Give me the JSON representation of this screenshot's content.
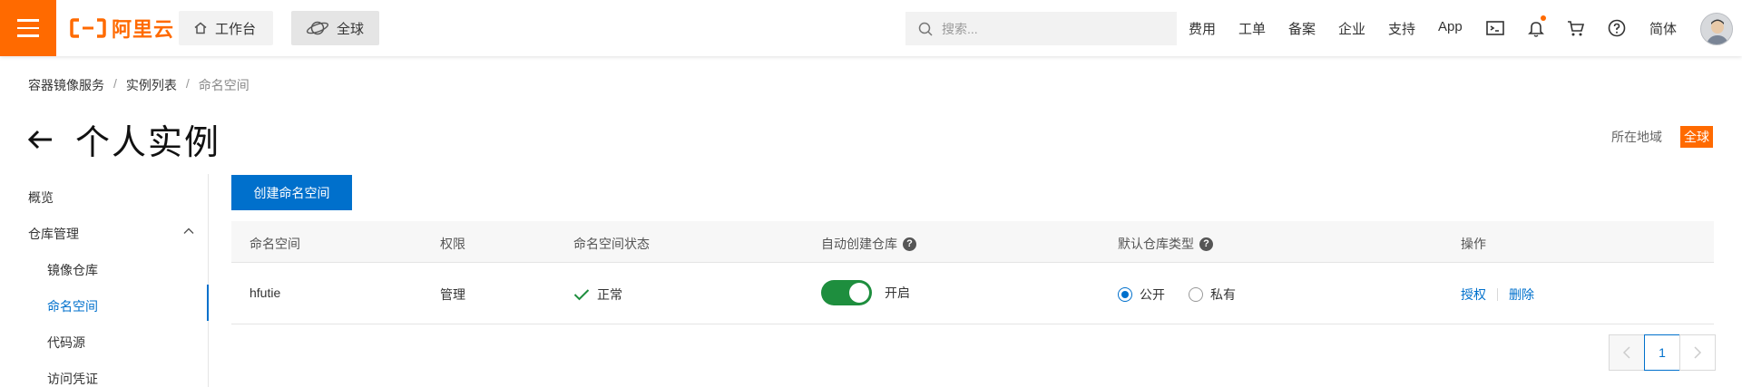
{
  "header": {
    "logo_text": "阿里云",
    "workbench_label": "工作台",
    "region_label": "全球",
    "search_placeholder": "搜索...",
    "links": [
      "费用",
      "工单",
      "备案",
      "企业",
      "支持",
      "App"
    ],
    "language_label": "简体"
  },
  "breadcrumb": [
    "容器镜像服务",
    "实例列表",
    "命名空间"
  ],
  "page": {
    "title": "个人实例",
    "region_caption": "所在地域",
    "region_value": "全球"
  },
  "sidebar": {
    "items": [
      {
        "label": "概览"
      },
      {
        "label": "仓库管理"
      },
      {
        "label": "镜像仓库"
      },
      {
        "label": "命名空间"
      },
      {
        "label": "代码源"
      },
      {
        "label": "访问凭证"
      }
    ]
  },
  "main": {
    "create_button": "创建命名空间",
    "columns": [
      "命名空间",
      "权限",
      "命名空间状态",
      "自动创建仓库",
      "默认仓库类型",
      "操作"
    ],
    "rows": [
      {
        "namespace": "hfutie",
        "permission": "管理",
        "status": "正常",
        "auto_create": "开启",
        "auto_create_on": true,
        "repo_type_options": [
          "公开",
          "私有"
        ],
        "repo_type_selected": "公开",
        "actions": [
          "授权",
          "删除"
        ]
      }
    ],
    "pagination": {
      "current_page": "1"
    }
  },
  "colors": {
    "brand_orange": "#ff6a00",
    "link_blue": "#0070cc",
    "toggle_green": "#1e8e3e"
  }
}
